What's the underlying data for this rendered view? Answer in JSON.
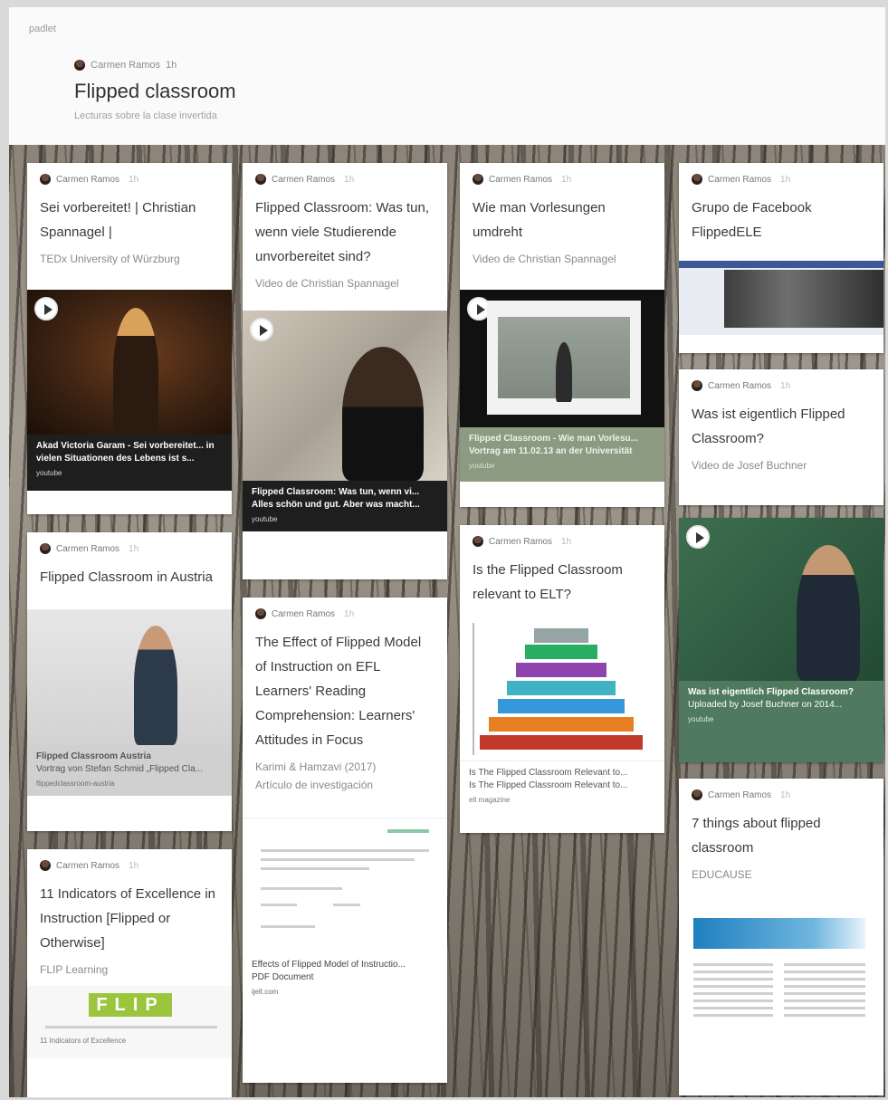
{
  "app": {
    "logo": "padlet"
  },
  "header": {
    "author": "Carmen Ramos",
    "time": "1h",
    "title": "Flipped classroom",
    "subtitle": "Lecturas sobre la clase invertida"
  },
  "cards": [
    {
      "author": "Carmen Ramos",
      "time": "1h",
      "title": "Sei vorbereitet! | Christian Spannagel |",
      "subtitle": "TEDx University of Würzburg",
      "media": {
        "type": "video",
        "caption_title": "Akad Victoria Garam - Sei vorbereitet... in vielen Situationen des Lebens ist s...",
        "caption_source": "youtube"
      }
    },
    {
      "author": "Carmen Ramos",
      "time": "1h",
      "title": "Flipped Classroom: Was tun, wenn viele Studierende unvorbereitet sind?",
      "subtitle": "Video de Christian Spannagel",
      "media": {
        "type": "video",
        "caption_title": "Flipped Classroom: Was tun, wenn vi... Alles schön und gut. Aber was macht...",
        "caption_source": "youtube"
      }
    },
    {
      "author": "Carmen Ramos",
      "time": "1h",
      "title": "Wie man Vorlesungen umdreht",
      "subtitle": "Video de Christian Spannagel",
      "media": {
        "type": "video",
        "caption_title": "Flipped Classroom - Wie man Vorlesu... Vortrag am 11.02.13 an der Universität",
        "caption_source": "youtube"
      }
    },
    {
      "author": "Carmen Ramos",
      "time": "1h",
      "title": "Grupo de Facebook FlippedELE",
      "subtitle": "",
      "media": {
        "type": "image"
      }
    },
    {
      "author": "Carmen Ramos",
      "time": "1h",
      "title": "Was ist eigentlich Flipped Classroom?",
      "subtitle": "Video de Josef Buchner",
      "media": {
        "type": "none"
      }
    },
    {
      "author": "Carmen Ramos",
      "time": "1h",
      "title": "Flipped Classroom in Austria",
      "subtitle": "",
      "media": {
        "type": "image",
        "caption_title": "Flipped Classroom Austria",
        "caption_line": "Vortrag von Stefan Schmid „Flipped Cla...",
        "caption_source": "flippedclassroom-austria"
      }
    },
    {
      "author": "Carmen Ramos",
      "time": "1h",
      "title": "The Effect of Flipped Model of Instruction on EFL Learners' Reading Comprehension: Learners' Attitudes in Focus",
      "subtitle": "Karimi & Hamzavi (2017)",
      "subtitle2": "Artículo de investigación",
      "media": {
        "type": "document",
        "caption_title": "Effects of Flipped Model of Instructio...",
        "caption_line": "PDF Document",
        "caption_source": "ijelt.com"
      }
    },
    {
      "author": "Carmen Ramos",
      "time": "1h",
      "title": "Is the Flipped Classroom relevant to ELT?",
      "subtitle": "",
      "media": {
        "type": "image",
        "caption_title": "Is The Flipped Classroom Relevant to...",
        "caption_line": "Is The Flipped Classroom Relevant to...",
        "caption_source": "elt magazine"
      }
    },
    {
      "author": "Carmen Ramos",
      "time": "1h",
      "title": "",
      "subtitle": "",
      "media": {
        "type": "video",
        "caption_title": "Was ist eigentlich Flipped Classroom?",
        "caption_line": "Uploaded by Josef Buchner on 2014...",
        "caption_source": "youtube"
      }
    },
    {
      "author": "Carmen Ramos",
      "time": "1h",
      "title": "7 things about flipped classroom",
      "subtitle": "EDUCAUSE",
      "media": {
        "type": "document"
      }
    },
    {
      "author": "Carmen Ramos",
      "time": "1h",
      "title": "11 Indicators of Excellence in Instruction [Flipped or Otherwise]",
      "subtitle": "FLIP Learning",
      "media": {
        "type": "image",
        "logo_text": "FLIP",
        "caption_title": "11 Indicators of Excellence"
      }
    }
  ],
  "colors": {
    "board_bg": "#8c8479",
    "card_bg": "#ffffff",
    "video_caption_bg": "#1e1e1e",
    "green_caption_bg": "#4f7a5f",
    "sage_caption_bg": "#8b9a80",
    "pyramid": [
      "#c0392b",
      "#e67e22",
      "#3498db",
      "#8e44ad",
      "#27ae60",
      "#95a5a6"
    ],
    "flip_logo": "#9bc53d"
  },
  "icons": {
    "play": "play-icon",
    "avatar": "avatar-icon"
  }
}
